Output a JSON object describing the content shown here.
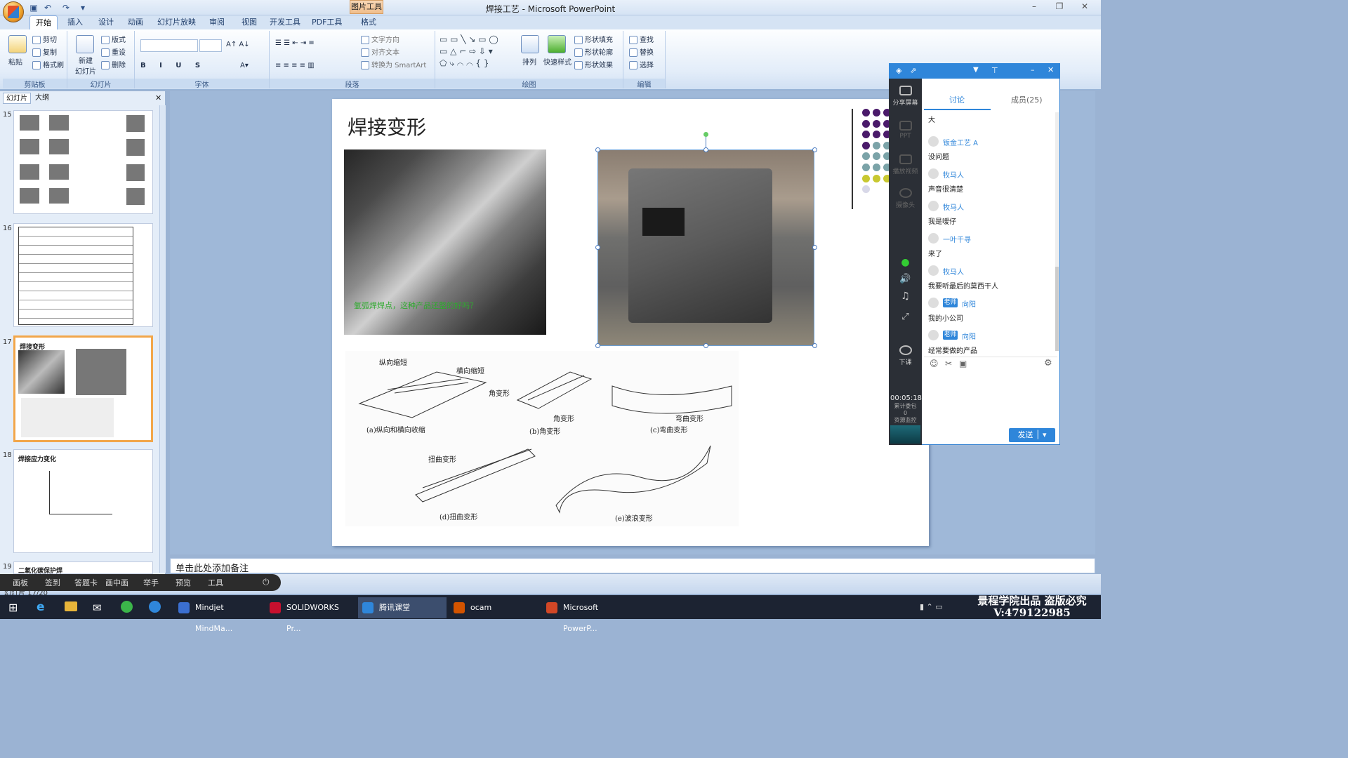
{
  "window": {
    "title": "焊接工艺 - Microsoft PowerPoint",
    "context_tab": "图片工具",
    "min": "–",
    "max": "❐",
    "close": "✕"
  },
  "ribbon_tabs": [
    "开始",
    "插入",
    "设计",
    "动画",
    "幻灯片放映",
    "审阅",
    "视图",
    "开发工具",
    "PDF工具",
    "格式"
  ],
  "ribbon": {
    "clipboard": {
      "label": "剪贴板",
      "paste": "粘贴",
      "cut": "剪切",
      "copy": "复制",
      "format_painter": "格式刷"
    },
    "slides": {
      "label": "幻灯片",
      "new_slide": "新建\n幻灯片",
      "layout": "版式",
      "reset": "重设",
      "delete": "删除"
    },
    "font": {
      "label": "字体"
    },
    "paragraph": {
      "label": "段落",
      "text_direction": "文字方向",
      "align_text": "对齐文本",
      "smartart": "转换为 SmartArt"
    },
    "drawing": {
      "label": "绘图",
      "arrange": "排列",
      "quick_styles": "快速样式",
      "shape_fill": "形状填充",
      "shape_outline": "形状轮廓",
      "shape_effects": "形状效果"
    },
    "editing": {
      "label": "编辑",
      "find": "查找",
      "replace": "替换",
      "select": "选择"
    }
  },
  "left_pane": {
    "tabs": [
      "幻灯片",
      "大纲"
    ],
    "close": "✕",
    "thumbs": [
      {
        "num": "15",
        "title": ""
      },
      {
        "num": "16",
        "title": ""
      },
      {
        "num": "17",
        "title": "焊接变形"
      },
      {
        "num": "18",
        "title": "焊接应力变化"
      },
      {
        "num": "19",
        "title": "二氧化碳保护焊"
      }
    ]
  },
  "slide": {
    "title": "焊接变形",
    "photo1_caption": "氩弧焊焊点，这种产品还整的好吗？",
    "diagram_labels": {
      "a1": "纵向缩短",
      "a2": "横向缩短",
      "a_cap": "(a)纵向和横向收缩",
      "b1": "角变形",
      "b2": "角变形",
      "b_cap": "(b)角变形",
      "c1": "弯曲变形",
      "c_cap": "(c)弯曲变形",
      "d1": "扭曲变形",
      "d_cap": "(d)扭曲变形",
      "e_cap": "(e)波浪变形"
    }
  },
  "notes_placeholder": "单击此处添加备注",
  "class_toolbar": [
    "画板",
    "签到",
    "答题卡",
    "画中画",
    "举手",
    "预览",
    "工具"
  ],
  "status_text": "幻灯片 17/20",
  "chat": {
    "side": {
      "share": "分享屏幕",
      "ppt": "PPT",
      "video": "播放视频",
      "camera": "摄像头",
      "end_class": "下课"
    },
    "timer": "00:05:18",
    "timer_sub1": "累计委包",
    "timer_sub2": "0",
    "timer_sub3": "资源监控",
    "tabs": {
      "discuss": "讨论",
      "members": "成员(25)"
    },
    "messages": [
      {
        "user": "",
        "teacher": false,
        "text": "大"
      },
      {
        "user": "钣金工艺 A",
        "teacher": false,
        "text": "没问题"
      },
      {
        "user": "牧马人",
        "teacher": false,
        "text": "声音很清楚"
      },
      {
        "user": "牧马人",
        "teacher": false,
        "text": "我是嗳仔"
      },
      {
        "user": "一叶千寻",
        "teacher": false,
        "text": "来了"
      },
      {
        "user": "牧马人",
        "teacher": false,
        "text": "我要听最后的莫西干人"
      },
      {
        "user": "向阳",
        "teacher": true,
        "text": "我的小公司"
      },
      {
        "user": "向阳",
        "teacher": true,
        "text": "经常要做的产品"
      }
    ],
    "teacher_badge": "老师",
    "send": "发送"
  },
  "taskbar": [
    {
      "label": "Mindjet MindMa...",
      "color": "#3b6fd1"
    },
    {
      "label": "SOLIDWORKS Pr...",
      "color": "#c8102e"
    },
    {
      "label": "腾讯课堂",
      "color": "#2f86da"
    },
    {
      "label": "ocam",
      "color": "#d35400"
    },
    {
      "label": "Microsoft PowerP...",
      "color": "#d24726"
    }
  ],
  "watermark": {
    "line1": "景程学院出品 盗版必究",
    "line2": "V:479122985"
  }
}
